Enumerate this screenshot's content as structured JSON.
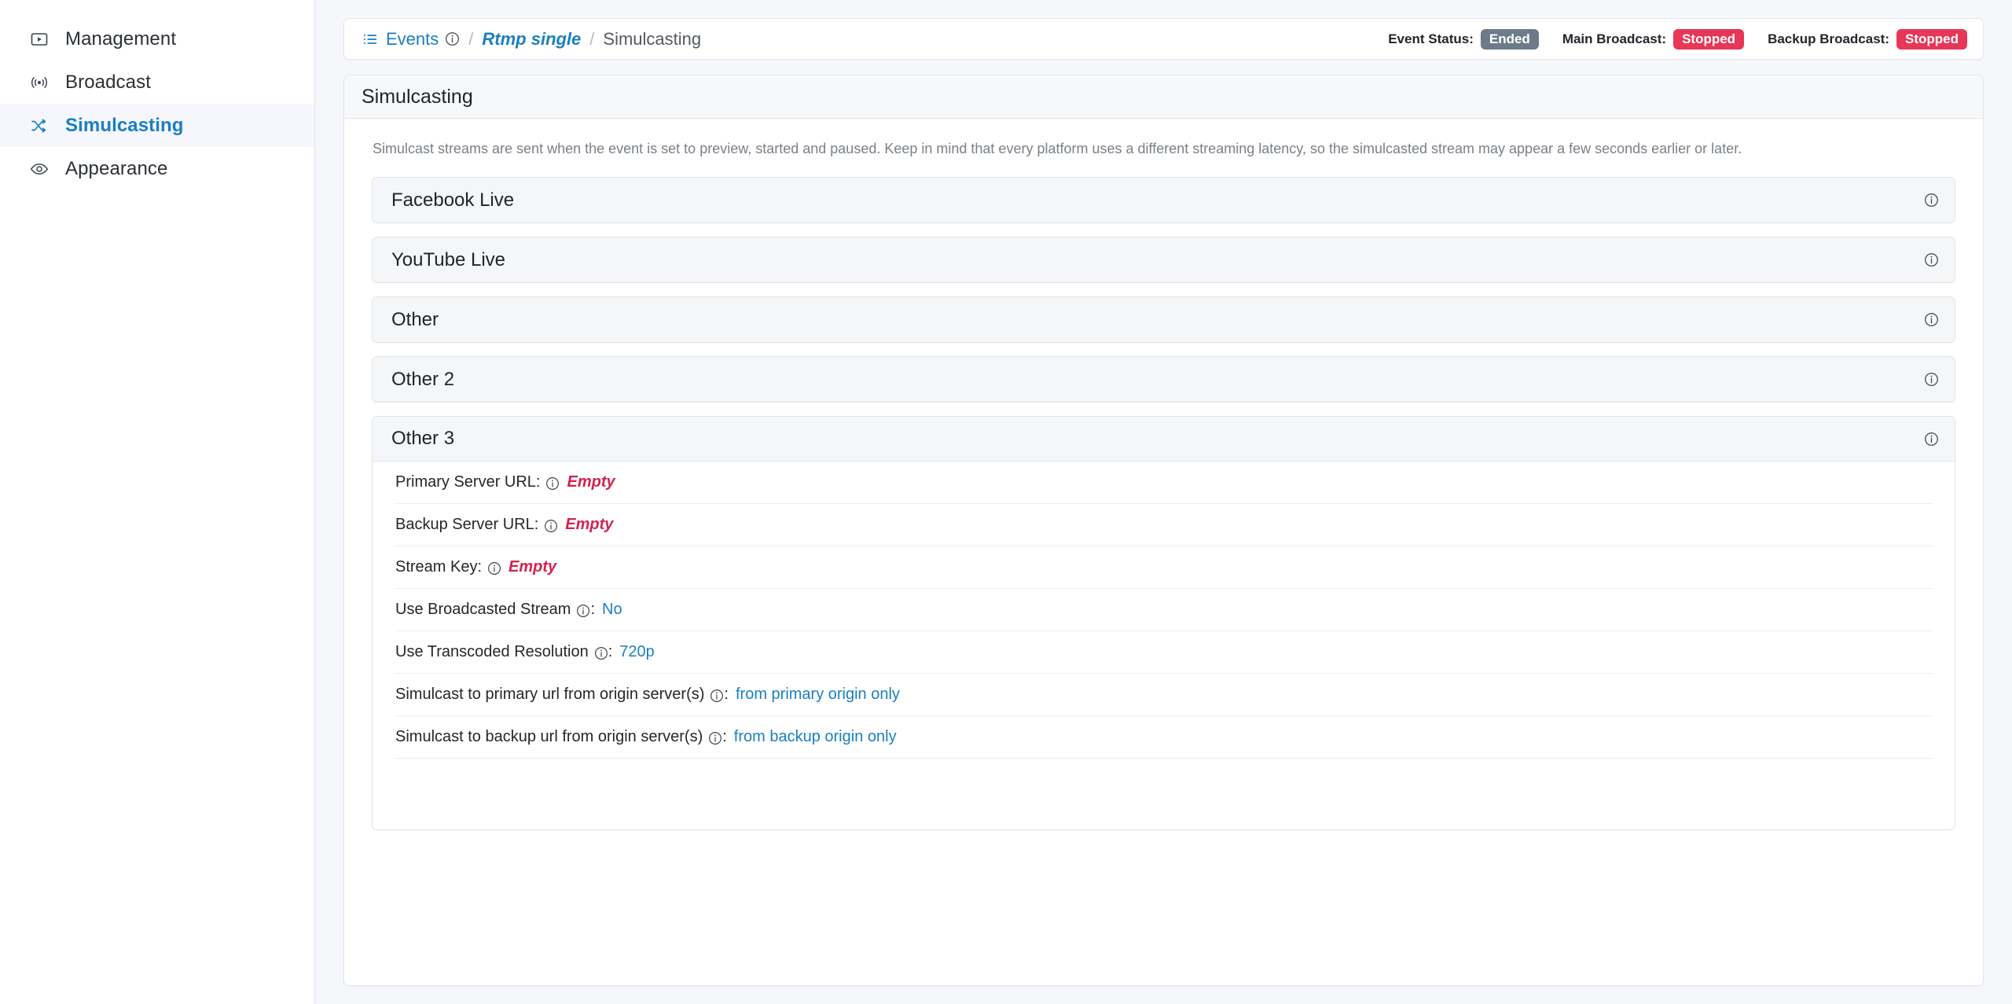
{
  "sidebar": {
    "items": [
      {
        "label": "Management",
        "icon": "video-player-icon",
        "active": false
      },
      {
        "label": "Broadcast",
        "icon": "broadcast-signal-icon",
        "active": false
      },
      {
        "label": "Simulcasting",
        "icon": "shuffle-icon",
        "active": true
      },
      {
        "label": "Appearance",
        "icon": "eye-icon",
        "active": false
      }
    ]
  },
  "breadcrumb": {
    "list_icon": "list-icon",
    "events_label": "Events",
    "events_info_icon": "info-icon",
    "separator": "/",
    "event_name": "Rtmp single",
    "current": "Simulcasting"
  },
  "statuses": [
    {
      "label": "Event Status:",
      "value": "Ended",
      "style": "gray"
    },
    {
      "label": "Main Broadcast:",
      "value": "Stopped",
      "style": "red"
    },
    {
      "label": "Backup Broadcast:",
      "value": "Stopped",
      "style": "red"
    }
  ],
  "card": {
    "title": "Simulcasting",
    "description": "Simulcast streams are sent when the event is set to preview, started and paused. Keep in mind that every platform uses a different streaming latency, so the simulcasted stream may appear a few seconds earlier or later."
  },
  "accordions": [
    {
      "title": "Facebook Live",
      "open": false,
      "info_icon": "info-icon"
    },
    {
      "title": "YouTube Live",
      "open": false,
      "info_icon": "info-icon"
    },
    {
      "title": "Other",
      "open": false,
      "info_icon": "info-icon"
    },
    {
      "title": "Other 2",
      "open": false,
      "info_icon": "info-icon"
    },
    {
      "title": "Other 3",
      "open": true,
      "info_icon": "info-icon"
    }
  ],
  "other3_fields": [
    {
      "label": "Primary Server URL:",
      "info_icon": "info-icon",
      "value": "Empty",
      "value_style": "empty"
    },
    {
      "label": "Backup Server URL:",
      "info_icon": "info-icon",
      "value": "Empty",
      "value_style": "empty"
    },
    {
      "label": "Stream Key:",
      "info_icon": "info-icon",
      "value": "Empty",
      "value_style": "empty"
    },
    {
      "label": "Use Broadcasted Stream",
      "info_icon": "info-icon",
      "suffix": ":",
      "value": "No",
      "value_style": "link"
    },
    {
      "label": "Use Transcoded Resolution",
      "info_icon": "info-icon",
      "suffix": ":",
      "value": "720p",
      "value_style": "link"
    },
    {
      "label": "Simulcast to primary url from origin server(s)",
      "info_icon": "info-icon",
      "suffix": ":",
      "value": "from primary origin only",
      "value_style": "link"
    },
    {
      "label": "Simulcast to backup url from origin server(s)",
      "info_icon": "info-icon",
      "suffix": ":",
      "value": "from backup origin only",
      "value_style": "link"
    }
  ],
  "colors": {
    "accent": "#1a7fc1",
    "danger": "#d6214d",
    "badge_gray": "#6c7a89",
    "badge_red": "#e63757",
    "page_bg": "#f5f7fb"
  }
}
